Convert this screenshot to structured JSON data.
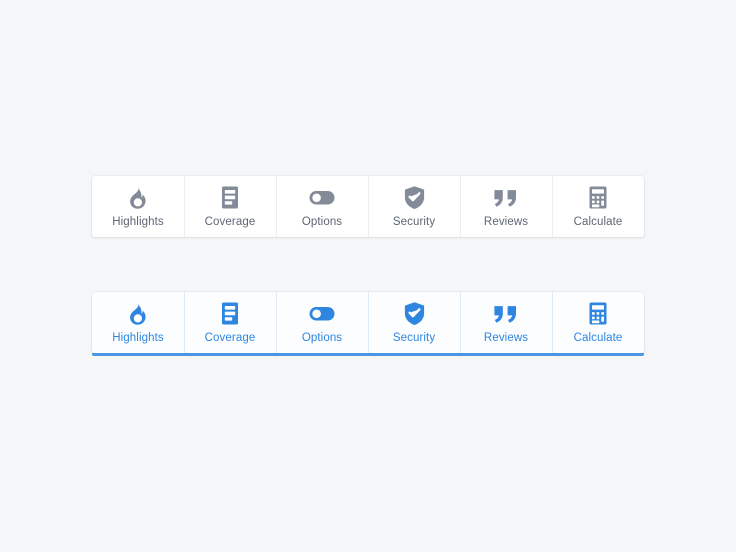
{
  "page": {
    "background_color": "#f5f6f7"
  },
  "theme": {
    "default_icon_color": "#838b99",
    "default_label_color": "#5d6674",
    "default_card_background": "#ffffff",
    "default_divider_color": "#edeff2",
    "active_icon_color": "#2e86e0",
    "active_label_color": "#2e86e0",
    "active_card_background": "#fbfdff",
    "active_divider_color": "#dcebfa",
    "active_underline_color": "#4a96e2"
  },
  "toolbars": [
    {
      "name": "default-state-toolbar",
      "state": "default",
      "items": [
        {
          "label": "Highlights",
          "icon": "flame-icon"
        },
        {
          "label": "Coverage",
          "icon": "document-list-icon"
        },
        {
          "label": "Options",
          "icon": "toggle-switch-icon"
        },
        {
          "label": "Security",
          "icon": "shield-check-icon"
        },
        {
          "label": "Reviews",
          "icon": "quote-marks-icon"
        },
        {
          "label": "Calculate",
          "icon": "calculator-icon"
        }
      ]
    },
    {
      "name": "active-state-toolbar",
      "state": "active",
      "items": [
        {
          "label": "Highlights",
          "icon": "flame-icon"
        },
        {
          "label": "Coverage",
          "icon": "document-list-icon"
        },
        {
          "label": "Options",
          "icon": "toggle-switch-icon"
        },
        {
          "label": "Security",
          "icon": "shield-check-icon"
        },
        {
          "label": "Reviews",
          "icon": "quote-marks-icon"
        },
        {
          "label": "Calculate",
          "icon": "calculator-icon"
        }
      ]
    }
  ]
}
